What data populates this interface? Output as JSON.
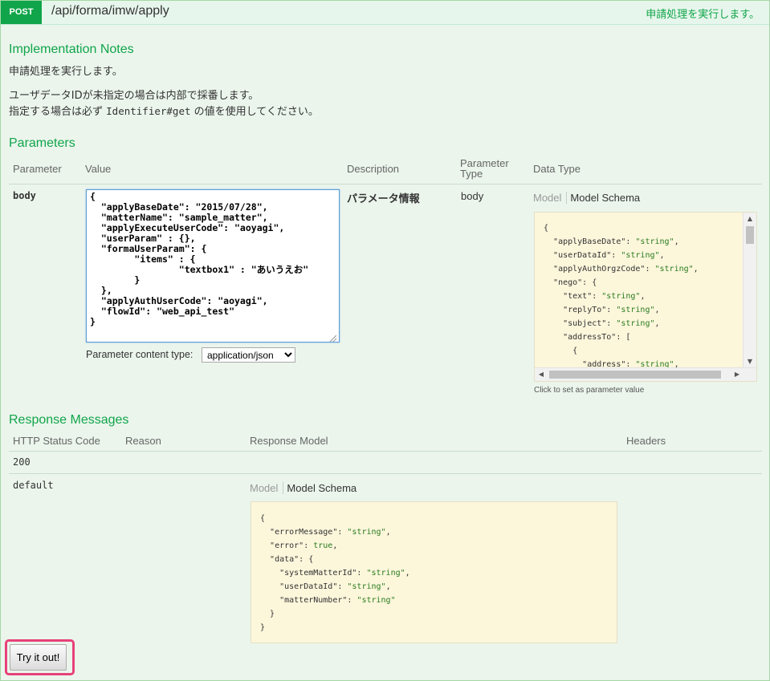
{
  "operation": {
    "method": "POST",
    "path": "/api/forma/imw/apply",
    "summary": "申請処理を実行します。"
  },
  "implementation_notes": {
    "title": "Implementation Notes",
    "line1": "申請処理を実行します。",
    "line2": "ユーザデータIDが未指定の場合は内部で採番します。",
    "line3_prefix": "指定する場合は必ず ",
    "line3_code": "Identifier#get",
    "line3_suffix": " の値を使用してください。"
  },
  "parameters": {
    "title": "Parameters",
    "headers": {
      "parameter": "Parameter",
      "value": "Value",
      "description": "Description",
      "parameter_type_1": "Parameter",
      "parameter_type_2": "Type",
      "data_type": "Data Type"
    },
    "body": {
      "name": "body",
      "value": "{\n  \"applyBaseDate\": \"2015/07/28\",\n  \"matterName\": \"sample_matter\",\n  \"applyExecuteUserCode\": \"aoyagi\",\n  \"userParam\" : {},\n  \"formaUserParam\": {\n        \"items\" : {\n                \"textbox1\" : \"あいうえお\"\n        }\n  },\n  \"applyAuthUserCode\": \"aoyagi\",\n  \"flowId\": \"web_api_test\"\n}",
      "content_type_label": "Parameter content type:",
      "content_type_selected": "application/json",
      "description": "パラメータ情報",
      "parameter_type": "body",
      "tab_model": "Model",
      "tab_model_schema": "Model Schema",
      "click_hint": "Click to set as parameter value",
      "schema_lines": [
        [
          [
            "p",
            "{"
          ]
        ],
        [
          [
            "p",
            "  "
          ],
          [
            "k",
            "\"applyBaseDate\""
          ],
          [
            "p",
            ": "
          ],
          [
            "s",
            "\"string\""
          ],
          [
            "p",
            ","
          ]
        ],
        [
          [
            "p",
            "  "
          ],
          [
            "k",
            "\"userDataId\""
          ],
          [
            "p",
            ": "
          ],
          [
            "s",
            "\"string\""
          ],
          [
            "p",
            ","
          ]
        ],
        [
          [
            "p",
            "  "
          ],
          [
            "k",
            "\"applyAuthOrgzCode\""
          ],
          [
            "p",
            ": "
          ],
          [
            "s",
            "\"string\""
          ],
          [
            "p",
            ","
          ]
        ],
        [
          [
            "p",
            "  "
          ],
          [
            "k",
            "\"nego\""
          ],
          [
            "p",
            ": {"
          ]
        ],
        [
          [
            "p",
            "    "
          ],
          [
            "k",
            "\"text\""
          ],
          [
            "p",
            ": "
          ],
          [
            "s",
            "\"string\""
          ],
          [
            "p",
            ","
          ]
        ],
        [
          [
            "p",
            "    "
          ],
          [
            "k",
            "\"replyTo\""
          ],
          [
            "p",
            ": "
          ],
          [
            "s",
            "\"string\""
          ],
          [
            "p",
            ","
          ]
        ],
        [
          [
            "p",
            "    "
          ],
          [
            "k",
            "\"subject\""
          ],
          [
            "p",
            ": "
          ],
          [
            "s",
            "\"string\""
          ],
          [
            "p",
            ","
          ]
        ],
        [
          [
            "p",
            "    "
          ],
          [
            "k",
            "\"addressTo\""
          ],
          [
            "p",
            ": ["
          ]
        ],
        [
          [
            "p",
            "      {"
          ]
        ],
        [
          [
            "p",
            "        "
          ],
          [
            "k",
            "\"address\""
          ],
          [
            "p",
            ": "
          ],
          [
            "s",
            "\"string\""
          ],
          [
            "p",
            ","
          ]
        ]
      ]
    }
  },
  "response_messages": {
    "title": "Response Messages",
    "headers": {
      "http_status_code": "HTTP Status Code",
      "reason": "Reason",
      "response_model": "Response Model",
      "headers": "Headers"
    },
    "rows": [
      {
        "code": "200"
      },
      {
        "code": "default"
      }
    ],
    "tab_model": "Model",
    "tab_model_schema": "Model Schema",
    "schema_lines": [
      [
        [
          "p",
          "{"
        ]
      ],
      [
        [
          "p",
          "  "
        ],
        [
          "k",
          "\"errorMessage\""
        ],
        [
          "p",
          ": "
        ],
        [
          "s",
          "\"string\""
        ],
        [
          "p",
          ","
        ]
      ],
      [
        [
          "p",
          "  "
        ],
        [
          "k",
          "\"error\""
        ],
        [
          "p",
          ": "
        ],
        [
          "b",
          "true"
        ],
        [
          "p",
          ","
        ]
      ],
      [
        [
          "p",
          "  "
        ],
        [
          "k",
          "\"data\""
        ],
        [
          "p",
          ": {"
        ]
      ],
      [
        [
          "p",
          "    "
        ],
        [
          "k",
          "\"systemMatterId\""
        ],
        [
          "p",
          ": "
        ],
        [
          "s",
          "\"string\""
        ],
        [
          "p",
          ","
        ]
      ],
      [
        [
          "p",
          "    "
        ],
        [
          "k",
          "\"userDataId\""
        ],
        [
          "p",
          ": "
        ],
        [
          "s",
          "\"string\""
        ],
        [
          "p",
          ","
        ]
      ],
      [
        [
          "p",
          "    "
        ],
        [
          "k",
          "\"matterNumber\""
        ],
        [
          "p",
          ": "
        ],
        [
          "s",
          "\"string\""
        ]
      ],
      [
        [
          "p",
          "  }"
        ]
      ],
      [
        [
          "p",
          "}"
        ]
      ]
    ]
  },
  "try_button_label": "Try it out!",
  "colors": {
    "accent": "#10a54a",
    "panel_background": "#ebf5ec",
    "snippet_background": "#fcf6db",
    "highlight": "#e8417a"
  }
}
